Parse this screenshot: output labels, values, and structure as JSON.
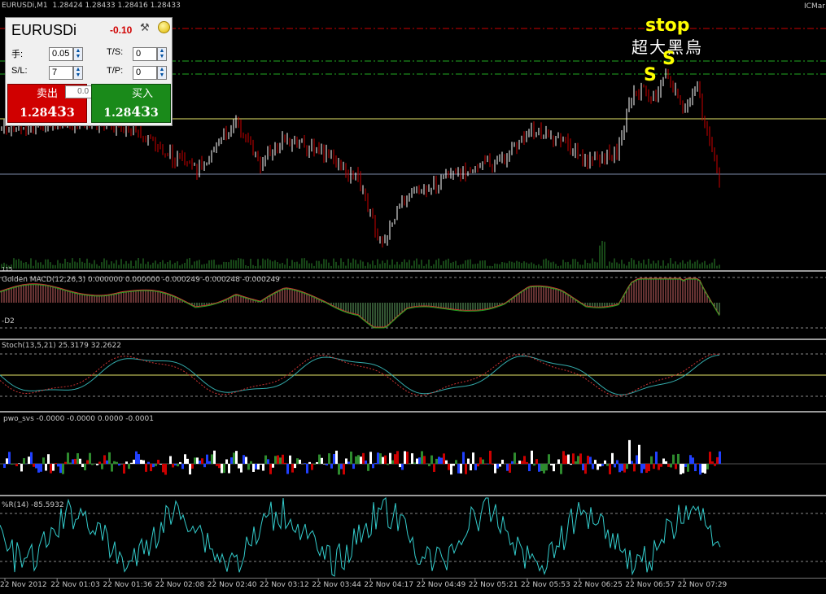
{
  "window": {
    "title": "EURUSDi,M1",
    "ohlc": "1.28424 1.28433 1.28416 1.28433",
    "broker_tag": "ICMar"
  },
  "trade_panel": {
    "symbol": "EURUSDi",
    "pnl": "-0.10",
    "lots_label": "手:",
    "lots_value": "0.05",
    "ts_label": "T/S:",
    "ts_value": "0",
    "sl_label": "S/L:",
    "sl_value": "7",
    "tp_label": "T/P:",
    "tp_value": "0",
    "spread_value": "0.0",
    "sell_label": "卖出",
    "buy_label": "买入",
    "sell_price_prefix": "1.28",
    "sell_price_big": "43",
    "sell_price_suffix": "3",
    "buy_price_prefix": "1.28",
    "buy_price_big": "43",
    "buy_price_suffix": "3"
  },
  "annotations": {
    "stop": "stop",
    "chinese": "超大黑烏",
    "s1": "S",
    "s2": "S"
  },
  "indicators": {
    "volume_label": "115",
    "macd_label": "Golden MACD(12,26,3) 0.000000 0.000000 -0.000249 -0.000248 -0.000249",
    "macd_left_label": "-D2",
    "stoch_label": "Stoch(13,5,21) 25.3179 32.2622",
    "pwo_label": "pwo_svs -0.0000 -0.0000 0.0000 -0.0001",
    "wpr_label": "%R(14) -85.5932"
  },
  "time_axis": [
    "22 Nov 2012",
    "22 Nov 01:03",
    "22 Nov 01:36",
    "22 Nov 02:08",
    "22 Nov 02:40",
    "22 Nov 03:12",
    "22 Nov 03:44",
    "22 Nov 04:17",
    "22 Nov 04:49",
    "22 Nov 05:21",
    "22 Nov 05:53",
    "22 Nov 06:25",
    "22 Nov 06:57",
    "22 Nov 07:29"
  ],
  "colors": {
    "background": "#000000",
    "bull": "#ffffff",
    "bear": "#cc0000",
    "volume": "#2e8b2e",
    "sell_button": "#d00000",
    "buy_button": "#1a8a1a",
    "annotation": "#ffff00",
    "level_line": "#ffff66",
    "stop_line": "#cc0000",
    "green_dash": "#22aa22",
    "wpr_line": "#33cccc"
  }
}
